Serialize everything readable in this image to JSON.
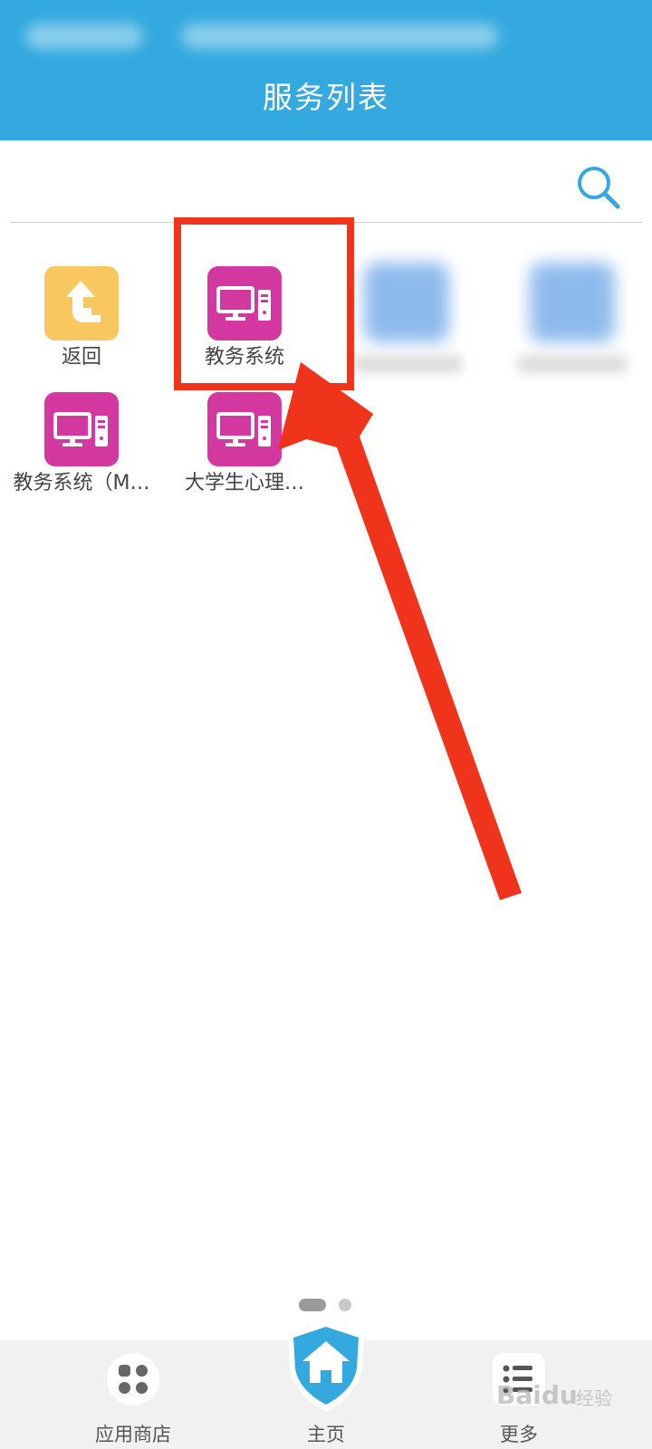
{
  "header": {
    "title": "服务列表",
    "color": "#33a9df"
  },
  "search": {
    "icon": "search-icon"
  },
  "apps": [
    {
      "label": "返回",
      "icon": "back-arrow-icon",
      "color": "#f9c760"
    },
    {
      "label": "教务系统",
      "icon": "computer-icon",
      "color": "#d2389f"
    },
    {
      "label": "教务系统（M…",
      "icon": "computer-icon",
      "color": "#d2389f"
    },
    {
      "label": "大学生心理…",
      "icon": "computer-icon",
      "color": "#d2389f"
    }
  ],
  "bottom_nav": {
    "store_label": "应用商店",
    "home_label": "主页",
    "more_label": "更多"
  },
  "watermark": {
    "text": "Baidu",
    "sub": "经验"
  },
  "colors": {
    "highlight": "#f0341c",
    "accent": "#33a9df"
  }
}
